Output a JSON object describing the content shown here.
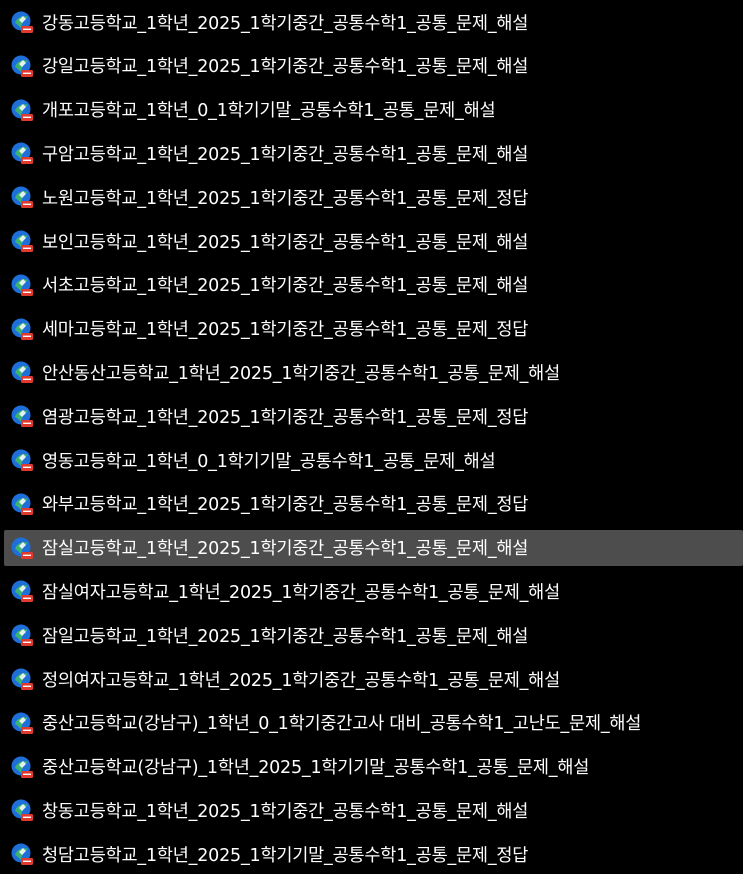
{
  "files": [
    {
      "name": "강동고등학교_1학년_2025_1학기중간_공통수학1_공통_문제_해설",
      "icon": "pdf-file-icon",
      "selected": false
    },
    {
      "name": "강일고등학교_1학년_2025_1학기중간_공통수학1_공통_문제_해설",
      "icon": "pdf-file-icon",
      "selected": false
    },
    {
      "name": "개포고등학교_1학년_0_1학기기말_공통수학1_공통_문제_해설",
      "icon": "pdf-file-icon",
      "selected": false
    },
    {
      "name": "구암고등학교_1학년_2025_1학기중간_공통수학1_공통_문제_해설",
      "icon": "pdf-file-icon",
      "selected": false
    },
    {
      "name": "노원고등학교_1학년_2025_1학기중간_공통수학1_공통_문제_정답",
      "icon": "pdf-file-icon",
      "selected": false
    },
    {
      "name": "보인고등학교_1학년_2025_1학기중간_공통수학1_공통_문제_해설",
      "icon": "pdf-file-icon",
      "selected": false
    },
    {
      "name": "서초고등학교_1학년_2025_1학기중간_공통수학1_공통_문제_해설",
      "icon": "pdf-file-icon",
      "selected": false
    },
    {
      "name": "세마고등학교_1학년_2025_1학기중간_공통수학1_공통_문제_정답",
      "icon": "pdf-file-icon",
      "selected": false
    },
    {
      "name": "안산동산고등학교_1학년_2025_1학기중간_공통수학1_공통_문제_해설",
      "icon": "pdf-file-icon",
      "selected": false
    },
    {
      "name": "염광고등학교_1학년_2025_1학기중간_공통수학1_공통_문제_정답",
      "icon": "pdf-file-icon",
      "selected": false
    },
    {
      "name": "영동고등학교_1학년_0_1학기기말_공통수학1_공통_문제_해설",
      "icon": "pdf-file-icon",
      "selected": false
    },
    {
      "name": "와부고등학교_1학년_2025_1학기중간_공통수학1_공통_문제_정답",
      "icon": "pdf-file-icon",
      "selected": false
    },
    {
      "name": "잠실고등학교_1학년_2025_1학기중간_공통수학1_공통_문제_해설",
      "icon": "pdf-file-icon",
      "selected": true
    },
    {
      "name": "잠실여자고등학교_1학년_2025_1학기중간_공통수학1_공통_문제_해설",
      "icon": "pdf-file-icon",
      "selected": false
    },
    {
      "name": "잠일고등학교_1학년_2025_1학기중간_공통수학1_공통_문제_해설",
      "icon": "pdf-file-icon",
      "selected": false
    },
    {
      "name": "정의여자고등학교_1학년_2025_1학기중간_공통수학1_공통_문제_해설",
      "icon": "pdf-file-icon",
      "selected": false
    },
    {
      "name": "중산고등학교(강남구)_1학년_0_1학기중간고사 대비_공통수학1_고난도_문제_해설",
      "icon": "pdf-file-icon",
      "selected": false
    },
    {
      "name": "중산고등학교(강남구)_1학년_2025_1학기기말_공통수학1_공통_문제_해설",
      "icon": "pdf-file-icon",
      "selected": false
    },
    {
      "name": "창동고등학교_1학년_2025_1학기중간_공통수학1_공통_문제_해설",
      "icon": "pdf-file-icon",
      "selected": false
    },
    {
      "name": "청담고등학교_1학년_2025_1학기기말_공통수학1_공통_문제_정답",
      "icon": "pdf-file-icon",
      "selected": false
    }
  ],
  "colors": {
    "background": "#000000",
    "text": "#ffffff",
    "selected_row": "#4d4d4d",
    "icon_blue": "#1e6fd9",
    "icon_green": "#3cb371",
    "icon_tag": "#e03a2f"
  }
}
